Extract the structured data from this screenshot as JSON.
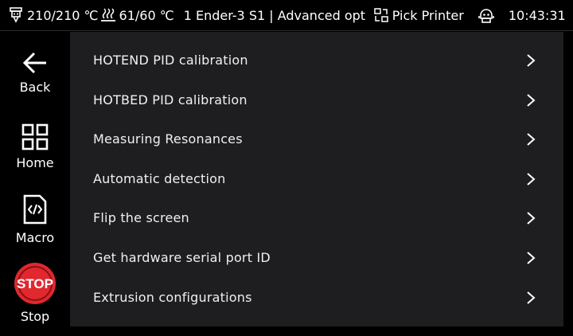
{
  "status_bar": {
    "hotend_temp": "210/210 ℃",
    "bed_temp": "61/60 ℃",
    "printer_title": "1 Ender-3 S1 | Advanced opt",
    "pick_printer": "Pick Printer",
    "time": "10:43:31"
  },
  "sidebar": {
    "back": "Back",
    "home": "Home",
    "macro": "Macro",
    "stop": "Stop",
    "stop_icon_text": "STOP",
    "stop_color": "#e0282e"
  },
  "menu": {
    "items": [
      {
        "label": "HOTEND PID calibration"
      },
      {
        "label": "HOTBED PID calibration"
      },
      {
        "label": "Measuring Resonances"
      },
      {
        "label": "Automatic detection"
      },
      {
        "label": "Flip the screen"
      },
      {
        "label": "Get hardware serial port ID"
      },
      {
        "label": "Extrusion configurations"
      }
    ]
  }
}
